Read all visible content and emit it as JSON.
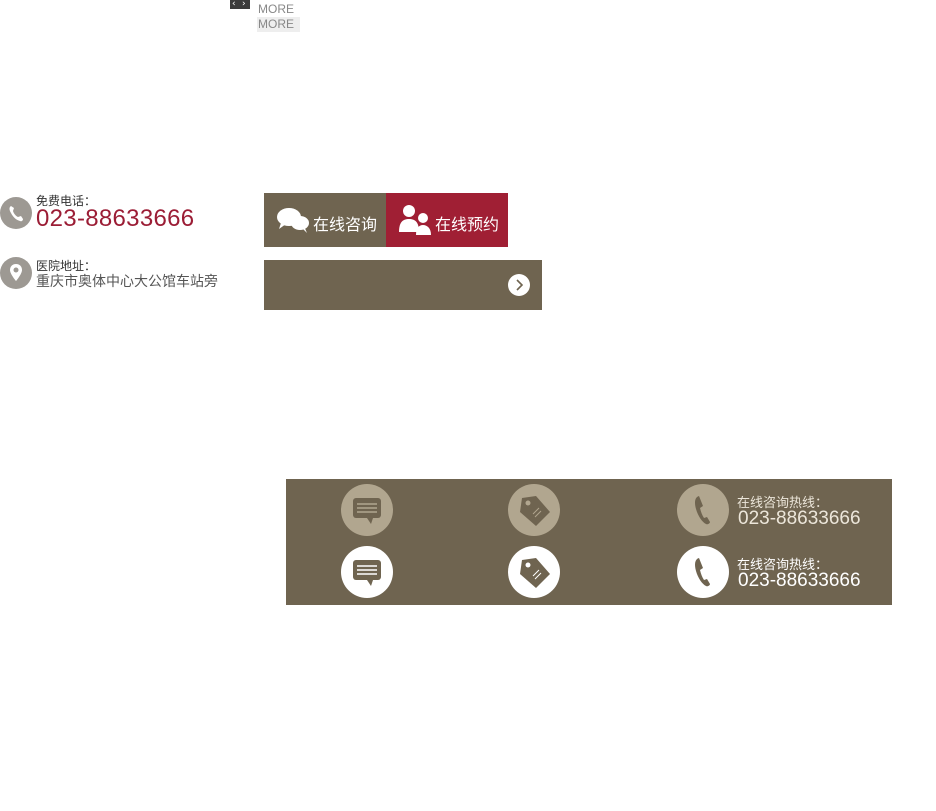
{
  "top": {
    "arrow_left": "‹",
    "arrow_right": "›",
    "more_1": "MORE",
    "more_2": "MORE"
  },
  "contact": {
    "phone_label": "免费电话：",
    "phone_number": "023-88633666",
    "address_label": "医院地址：",
    "address_value": "重庆市奥体中心大公馆车站旁"
  },
  "actions": {
    "consult_label": "在线咨询",
    "book_label": "在线预约"
  },
  "footer": {
    "hotline_label": "在线咨询热线：",
    "hotline_number": "023-88633666"
  },
  "colors": {
    "brand_brown": "#6f6450",
    "brand_red": "#a01f34",
    "phone_red": "#9b1d35"
  },
  "icons": [
    "phone-icon",
    "location-icon",
    "chat-icon",
    "people-icon",
    "arrow-right-icon",
    "tag-icon"
  ]
}
